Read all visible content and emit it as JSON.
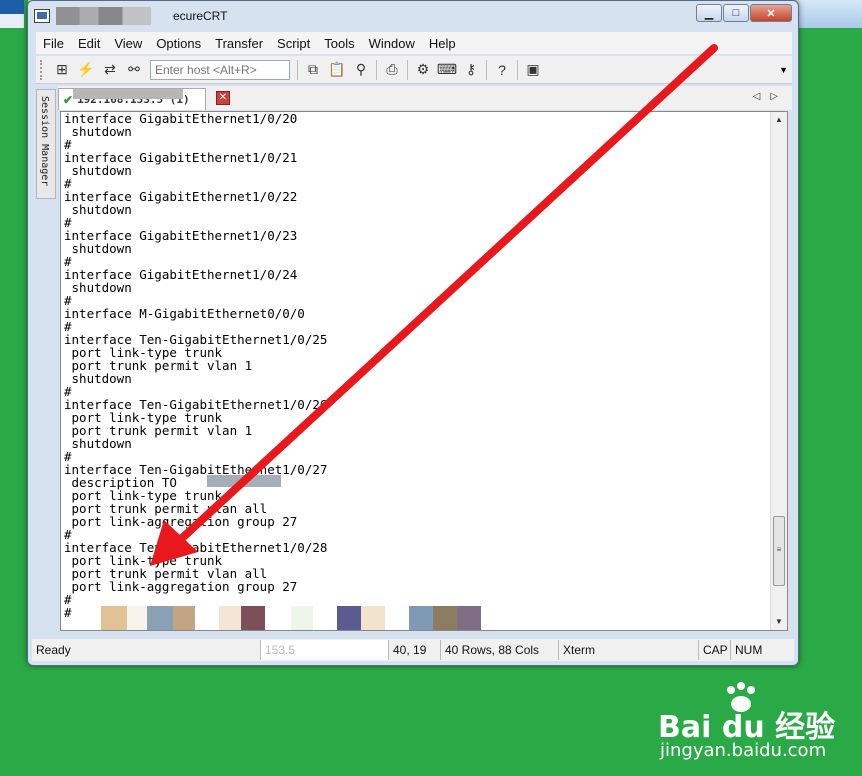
{
  "window": {
    "title": "ecureCRT",
    "buttons": {
      "minimize": "▁",
      "maximize": "□",
      "close": "✕"
    }
  },
  "menu": [
    "File",
    "Edit",
    "View",
    "Options",
    "Transfer",
    "Script",
    "Tools",
    "Window",
    "Help"
  ],
  "toolbar": {
    "host_placeholder": "Enter host <Alt+R>",
    "icons": [
      "connect-icon",
      "quick-connect-icon",
      "reconnect-icon",
      "disconnect-icon",
      "copy-icon",
      "paste-icon",
      "find-icon",
      "print-icon",
      "settings-icon",
      "keymap-icon",
      "sftp-icon",
      "help-icon",
      "screen-icon"
    ]
  },
  "session_manager": {
    "label": "Session Manager"
  },
  "tab": {
    "label": "192.168.153.5 (1)"
  },
  "terminal": {
    "lines": [
      "interface GigabitEthernet1/0/20",
      " shutdown",
      "#",
      "interface GigabitEthernet1/0/21",
      " shutdown",
      "#",
      "interface GigabitEthernet1/0/22",
      " shutdown",
      "#",
      "interface GigabitEthernet1/0/23",
      " shutdown",
      "#",
      "interface GigabitEthernet1/0/24",
      " shutdown",
      "#",
      "interface M-GigabitEthernet0/0/0",
      "#",
      "interface Ten-GigabitEthernet1/0/25",
      " port link-type trunk",
      " port trunk permit vlan 1",
      " shutdown",
      "#",
      "interface Ten-GigabitEthernet1/0/26",
      " port link-type trunk",
      " port trunk permit vlan 1",
      " shutdown",
      "#",
      "interface Ten-GigabitEthernet1/0/27",
      " description TO",
      " port link-type trunk",
      " port trunk permit vlan all",
      " port link-aggregation group 27",
      "#",
      "interface Ten-GigabitEthernet1/0/28",
      " port link-type trunk",
      " port trunk permit vlan all",
      " port link-aggregation group 27",
      "#",
      "",
      "#"
    ]
  },
  "status": {
    "ready": "Ready",
    "blurred": "153.5",
    "cursor": "40,  19",
    "size": "40 Rows, 88 Cols",
    "term": "Xterm",
    "cap": "CAP",
    "num": "NUM"
  },
  "watermark": {
    "brand": "Bai du 经验",
    "url": "jingyan.baidu.com"
  },
  "colors": {
    "background": "#2aaa46",
    "arrow": "#e8191c"
  }
}
